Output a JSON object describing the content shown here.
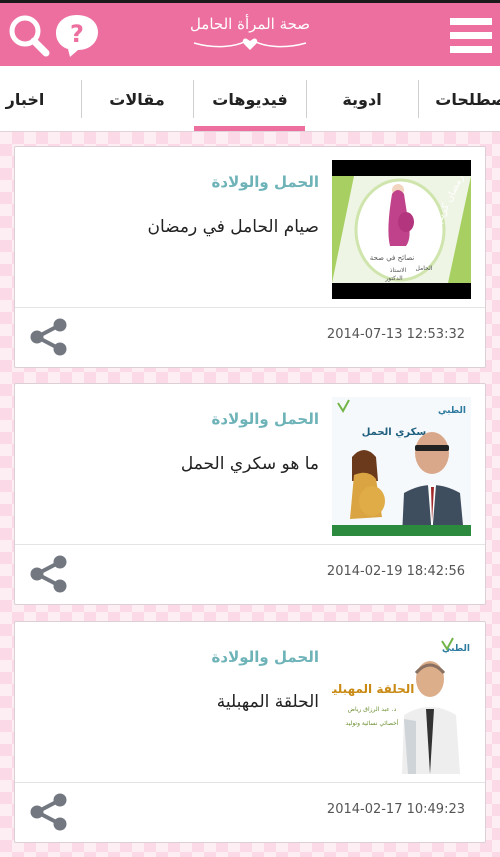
{
  "header": {
    "app_title": "صحة المرأة الحامل",
    "icons": {
      "search": "search-icon",
      "help": "help-bubble-icon",
      "menu": "hamburger-menu-icon"
    },
    "colors": {
      "header": "#ec6f9f",
      "accent": "#ec6f9f",
      "category": "#6db3b8"
    }
  },
  "tabs": [
    {
      "label": "مصطلحات"
    },
    {
      "label": "ادوية"
    },
    {
      "label": "فيديوهات",
      "active": true
    },
    {
      "label": "مقالات"
    },
    {
      "label": "اخبار"
    }
  ],
  "items": [
    {
      "category": "الحمل والولادة",
      "title": "صيام الحامل في رمضان",
      "datetime": "2014-07-13 12:53:32",
      "thumb": {
        "banner": "رمضان كريم",
        "caption": [
          "نصائح في صحة",
          "الحامل",
          "الاستاذ",
          "الدكتور"
        ]
      }
    },
    {
      "category": "الحمل والولادة",
      "title": "ما هو سكري الحمل",
      "datetime": "2014-02-19 18:42:56",
      "thumb": {
        "logo": "الطبي",
        "heading": "سكري الحمل"
      }
    },
    {
      "category": "الحمل والولادة",
      "title": "الحلقة المهبلية",
      "datetime": "2014-02-17 10:49:23",
      "thumb": {
        "logo": "الطبي",
        "heading": "الحلقة المهبلية",
        "lines": [
          "د. عبد الرزاق رياض",
          "أخصائي نسائية وتوليد"
        ]
      }
    }
  ]
}
